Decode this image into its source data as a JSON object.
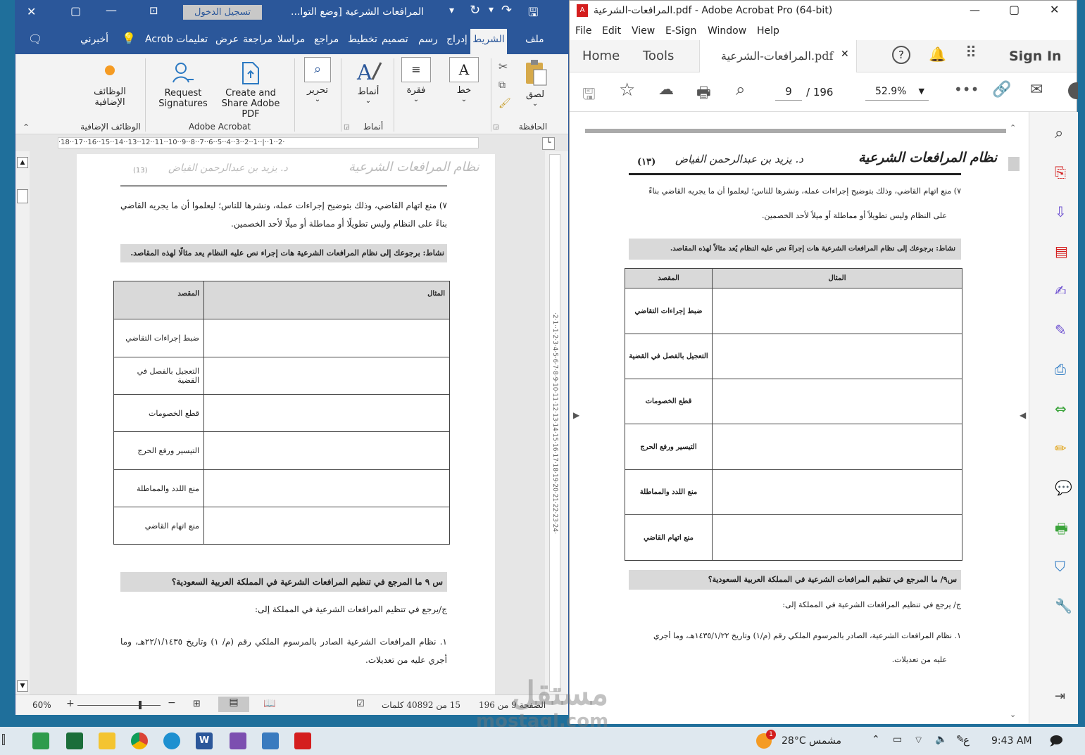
{
  "word": {
    "title": "المرافعات الشرعية [وضع التوا...",
    "signin": "تسجيل الدخول",
    "tabs": [
      "ملف",
      "الشريط",
      "إدراج",
      "رسم",
      "تصميم",
      "تخطيط",
      "مراجع",
      "مراسلا",
      "مراجعة",
      "عرض",
      "تعليمات",
      "Acrob",
      "أخبرني"
    ],
    "ribbon": {
      "paste": "لصق",
      "clipboard": "الحافظة",
      "font": "خط",
      "paragraph": "فقرة",
      "styles": "أنماط",
      "styles_group": "أنماط",
      "editing": "تحرير",
      "create_pdf": "Create and Share Adobe PDF",
      "request_sig": "Request Signatures",
      "adobe_group": "Adobe Acrobat",
      "addins": "الوظائف الإضافية",
      "addins_group": "الوظائف الإضافية"
    },
    "ruler": "·18··17··16··15··14··13··12··11··10··9··8··7··6··5··4··3··2··1··|··1··2·",
    "page": {
      "header_num": "(13)",
      "header_title": "نظام المرافعات الشرعية",
      "header_author": "د. يزيد بن عبدالرحمن الفياض",
      "para1": "٧) منع اتهام القاضي، وذلك بتوضيح إجراءات عمله، ونشرها للناس؛ ليعلموا أن ما يجريه القاضي بناءً على النظام وليس تطويلًا أو مماطلة أو ميلًا لأحد الخصمين.",
      "activity": "نشاط: برجوعك إلى نظام المرافعات الشرعية هات إجراء نص عليه النظام يعد مثالًا لهذه المقاصد.",
      "table_head": [
        "المقصد",
        "المثال"
      ],
      "table_rows": [
        "ضبط إجراءات التقاضي",
        "التعجيل بالفصل في القضية",
        "قطع الخصومات",
        "التيسير ورفع الحرج",
        "منع اللدد والمماطلة",
        "منع اتهام القاضي"
      ],
      "q9": "س ٩ ما المرجع في تنظيم المرافعات الشرعية في المملكة العربية السعودية؟",
      "a9": "ج/يرجع في تنظيم المرافعات الشرعية في المملكة إلى:",
      "item1": "١. نظام المرافعات الشرعية الصادر بالمرسوم الملكي رقم (م/ ١) وتاريخ ٢٢/١/١٤٣٥هـ، وما أجري عليه من تعديلات."
    },
    "status": {
      "page": "الصفحة 9 من 196",
      "words": "15 من 40892 كلمات",
      "zoom": "60%"
    }
  },
  "acrobat": {
    "title": "المرافعات-الشرعية.pdf - Adobe Acrobat Pro (64-bit)",
    "menu": [
      "File",
      "Edit",
      "View",
      "E-Sign",
      "Window",
      "Help"
    ],
    "tabs": [
      "Home",
      "Tools"
    ],
    "doc_tab": "المرافعات-الشرعية.pdf",
    "sign_in": "Sign In",
    "page_current": "9",
    "page_total": "/ 196",
    "zoom": "52.9%",
    "page": {
      "header_num": "(١٣)",
      "header_title": "نظام المرافعات الشرعية",
      "header_author": "د. يزيد بن عبدالرحمن الفياض",
      "para1a": "٧) منع اتهام القاضي، وذلك بتوضيح إجراءات عمله، ونشرها للناس؛ ليعلموا أن ما يجريه القاضي بناءً",
      "para1b": "على النظام وليس تطويلاً أو مماطلة أو ميلاً لأحد الخصمين.",
      "activity": "نشاط: برجوعك إلى نظام المرافعات الشرعية هات إجراءً نص عليه النظام يُعد مثالاً لهذه المقاصد.",
      "table_head": [
        "المقصد",
        "المثال"
      ],
      "table_rows": [
        "ضبط إجراءات التقاضي",
        "التعجيل بالفصل في القضية",
        "قطع الخصومات",
        "التيسير ورفع الحرج",
        "منع اللدد والمماطلة",
        "منع اتهام القاضي"
      ],
      "q9": "س٩/ ما المرجع في تنظيم المرافعات الشرعية في المملكة العربية السعودية؟",
      "a9": "ج/ يرجع في تنظيم المرافعات الشرعية في المملكة إلى:",
      "item1a": "١. نظام المرافعات الشرعية، الصادر بالمرسوم الملكي رقم (م/١) وتاريخ ١٤٣٥/١/٢٢هـ، وما أُجري",
      "item1b": "عليه من تعديلات."
    }
  },
  "taskbar": {
    "weather": "28°C مشمس",
    "lang": "ع",
    "time": "9:43 AM",
    "badge": "1"
  },
  "watermark": {
    "ar": "مستقل",
    "en": "mostaql.com"
  },
  "colors": {
    "word_blue": "#2b579a",
    "acrobat_red": "#d41e1e",
    "tool_purple": "#6c4fd0"
  }
}
